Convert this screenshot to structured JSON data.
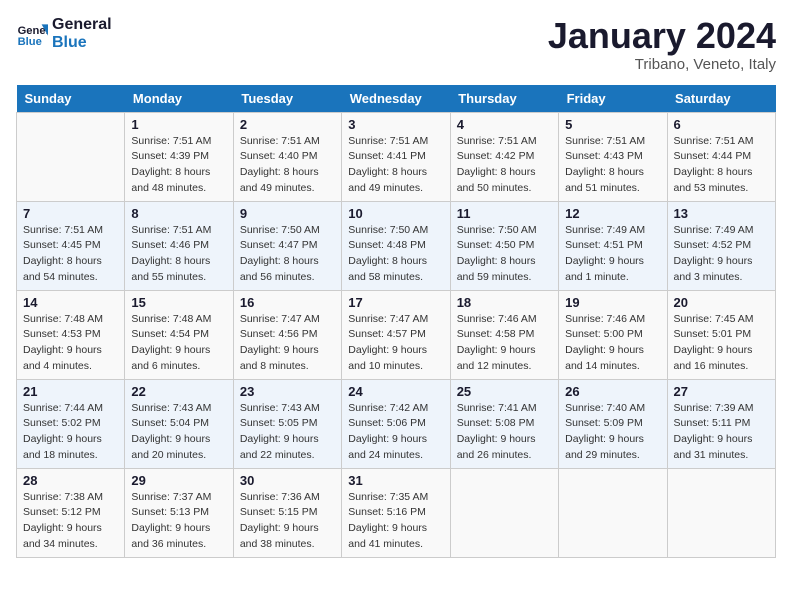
{
  "header": {
    "logo_line1": "General",
    "logo_line2": "Blue",
    "title": "January 2024",
    "subtitle": "Tribano, Veneto, Italy"
  },
  "days_of_week": [
    "Sunday",
    "Monday",
    "Tuesday",
    "Wednesday",
    "Thursday",
    "Friday",
    "Saturday"
  ],
  "weeks": [
    [
      {
        "day": "",
        "sunrise": "",
        "sunset": "",
        "daylight": ""
      },
      {
        "day": "1",
        "sunrise": "Sunrise: 7:51 AM",
        "sunset": "Sunset: 4:39 PM",
        "daylight": "Daylight: 8 hours and 48 minutes."
      },
      {
        "day": "2",
        "sunrise": "Sunrise: 7:51 AM",
        "sunset": "Sunset: 4:40 PM",
        "daylight": "Daylight: 8 hours and 49 minutes."
      },
      {
        "day": "3",
        "sunrise": "Sunrise: 7:51 AM",
        "sunset": "Sunset: 4:41 PM",
        "daylight": "Daylight: 8 hours and 49 minutes."
      },
      {
        "day": "4",
        "sunrise": "Sunrise: 7:51 AM",
        "sunset": "Sunset: 4:42 PM",
        "daylight": "Daylight: 8 hours and 50 minutes."
      },
      {
        "day": "5",
        "sunrise": "Sunrise: 7:51 AM",
        "sunset": "Sunset: 4:43 PM",
        "daylight": "Daylight: 8 hours and 51 minutes."
      },
      {
        "day": "6",
        "sunrise": "Sunrise: 7:51 AM",
        "sunset": "Sunset: 4:44 PM",
        "daylight": "Daylight: 8 hours and 53 minutes."
      }
    ],
    [
      {
        "day": "7",
        "sunrise": "Sunrise: 7:51 AM",
        "sunset": "Sunset: 4:45 PM",
        "daylight": "Daylight: 8 hours and 54 minutes."
      },
      {
        "day": "8",
        "sunrise": "Sunrise: 7:51 AM",
        "sunset": "Sunset: 4:46 PM",
        "daylight": "Daylight: 8 hours and 55 minutes."
      },
      {
        "day": "9",
        "sunrise": "Sunrise: 7:50 AM",
        "sunset": "Sunset: 4:47 PM",
        "daylight": "Daylight: 8 hours and 56 minutes."
      },
      {
        "day": "10",
        "sunrise": "Sunrise: 7:50 AM",
        "sunset": "Sunset: 4:48 PM",
        "daylight": "Daylight: 8 hours and 58 minutes."
      },
      {
        "day": "11",
        "sunrise": "Sunrise: 7:50 AM",
        "sunset": "Sunset: 4:50 PM",
        "daylight": "Daylight: 8 hours and 59 minutes."
      },
      {
        "day": "12",
        "sunrise": "Sunrise: 7:49 AM",
        "sunset": "Sunset: 4:51 PM",
        "daylight": "Daylight: 9 hours and 1 minute."
      },
      {
        "day": "13",
        "sunrise": "Sunrise: 7:49 AM",
        "sunset": "Sunset: 4:52 PM",
        "daylight": "Daylight: 9 hours and 3 minutes."
      }
    ],
    [
      {
        "day": "14",
        "sunrise": "Sunrise: 7:48 AM",
        "sunset": "Sunset: 4:53 PM",
        "daylight": "Daylight: 9 hours and 4 minutes."
      },
      {
        "day": "15",
        "sunrise": "Sunrise: 7:48 AM",
        "sunset": "Sunset: 4:54 PM",
        "daylight": "Daylight: 9 hours and 6 minutes."
      },
      {
        "day": "16",
        "sunrise": "Sunrise: 7:47 AM",
        "sunset": "Sunset: 4:56 PM",
        "daylight": "Daylight: 9 hours and 8 minutes."
      },
      {
        "day": "17",
        "sunrise": "Sunrise: 7:47 AM",
        "sunset": "Sunset: 4:57 PM",
        "daylight": "Daylight: 9 hours and 10 minutes."
      },
      {
        "day": "18",
        "sunrise": "Sunrise: 7:46 AM",
        "sunset": "Sunset: 4:58 PM",
        "daylight": "Daylight: 9 hours and 12 minutes."
      },
      {
        "day": "19",
        "sunrise": "Sunrise: 7:46 AM",
        "sunset": "Sunset: 5:00 PM",
        "daylight": "Daylight: 9 hours and 14 minutes."
      },
      {
        "day": "20",
        "sunrise": "Sunrise: 7:45 AM",
        "sunset": "Sunset: 5:01 PM",
        "daylight": "Daylight: 9 hours and 16 minutes."
      }
    ],
    [
      {
        "day": "21",
        "sunrise": "Sunrise: 7:44 AM",
        "sunset": "Sunset: 5:02 PM",
        "daylight": "Daylight: 9 hours and 18 minutes."
      },
      {
        "day": "22",
        "sunrise": "Sunrise: 7:43 AM",
        "sunset": "Sunset: 5:04 PM",
        "daylight": "Daylight: 9 hours and 20 minutes."
      },
      {
        "day": "23",
        "sunrise": "Sunrise: 7:43 AM",
        "sunset": "Sunset: 5:05 PM",
        "daylight": "Daylight: 9 hours and 22 minutes."
      },
      {
        "day": "24",
        "sunrise": "Sunrise: 7:42 AM",
        "sunset": "Sunset: 5:06 PM",
        "daylight": "Daylight: 9 hours and 24 minutes."
      },
      {
        "day": "25",
        "sunrise": "Sunrise: 7:41 AM",
        "sunset": "Sunset: 5:08 PM",
        "daylight": "Daylight: 9 hours and 26 minutes."
      },
      {
        "day": "26",
        "sunrise": "Sunrise: 7:40 AM",
        "sunset": "Sunset: 5:09 PM",
        "daylight": "Daylight: 9 hours and 29 minutes."
      },
      {
        "day": "27",
        "sunrise": "Sunrise: 7:39 AM",
        "sunset": "Sunset: 5:11 PM",
        "daylight": "Daylight: 9 hours and 31 minutes."
      }
    ],
    [
      {
        "day": "28",
        "sunrise": "Sunrise: 7:38 AM",
        "sunset": "Sunset: 5:12 PM",
        "daylight": "Daylight: 9 hours and 34 minutes."
      },
      {
        "day": "29",
        "sunrise": "Sunrise: 7:37 AM",
        "sunset": "Sunset: 5:13 PM",
        "daylight": "Daylight: 9 hours and 36 minutes."
      },
      {
        "day": "30",
        "sunrise": "Sunrise: 7:36 AM",
        "sunset": "Sunset: 5:15 PM",
        "daylight": "Daylight: 9 hours and 38 minutes."
      },
      {
        "day": "31",
        "sunrise": "Sunrise: 7:35 AM",
        "sunset": "Sunset: 5:16 PM",
        "daylight": "Daylight: 9 hours and 41 minutes."
      },
      {
        "day": "",
        "sunrise": "",
        "sunset": "",
        "daylight": ""
      },
      {
        "day": "",
        "sunrise": "",
        "sunset": "",
        "daylight": ""
      },
      {
        "day": "",
        "sunrise": "",
        "sunset": "",
        "daylight": ""
      }
    ]
  ]
}
